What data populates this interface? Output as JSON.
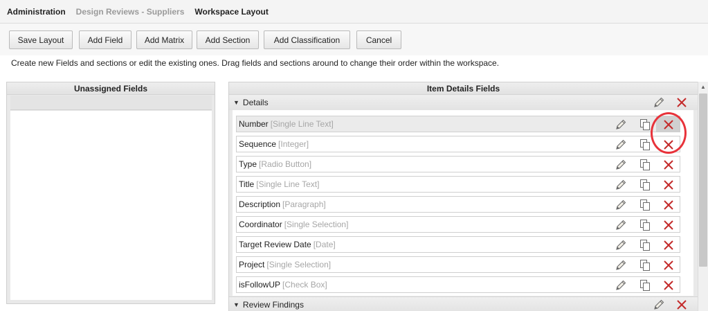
{
  "breadcrumb": [
    "Administration",
    "Design Reviews - Suppliers",
    "Workspace Layout"
  ],
  "toolbar": {
    "save_layout": "Save Layout",
    "add_field": "Add Field",
    "add_matrix": "Add Matrix",
    "add_section": "Add Section",
    "add_classification": "Add Classification",
    "cancel": "Cancel"
  },
  "instructions": "Create new Fields and sections or edit the existing ones. Drag fields and sections around to change their order within the workspace.",
  "unassigned": {
    "title": "Unassigned Fields"
  },
  "item_details": {
    "title": "Item Details Fields",
    "sections": [
      {
        "title": "Details",
        "expanded": true,
        "fields": [
          {
            "name": "Number",
            "type": "[Single Line Text]",
            "highlighted": true
          },
          {
            "name": "Sequence",
            "type": "[Integer]"
          },
          {
            "name": "Type",
            "type": "[Radio Button]"
          },
          {
            "name": "Title",
            "type": "[Single Line Text]"
          },
          {
            "name": "Description",
            "type": "[Paragraph]"
          },
          {
            "name": "Coordinator",
            "type": "[Single Selection]"
          },
          {
            "name": "Target Review Date",
            "type": "[Date]"
          },
          {
            "name": "Project",
            "type": "[Single Selection]"
          },
          {
            "name": "isFollowUP",
            "type": "[Check Box]"
          }
        ]
      },
      {
        "title": "Review Findings",
        "expanded": true,
        "fields": []
      }
    ]
  },
  "icons": {
    "edit": "pencil-icon",
    "copy": "copy-icon",
    "delete": "delete-x-icon",
    "expand": "triangle-down-icon"
  },
  "colors": {
    "delete_x": "#c42b2b",
    "annotation_circle": "#e8323a",
    "field_type_text": "#a6a6a6",
    "breadcrumb_muted": "#9a9a9a"
  }
}
